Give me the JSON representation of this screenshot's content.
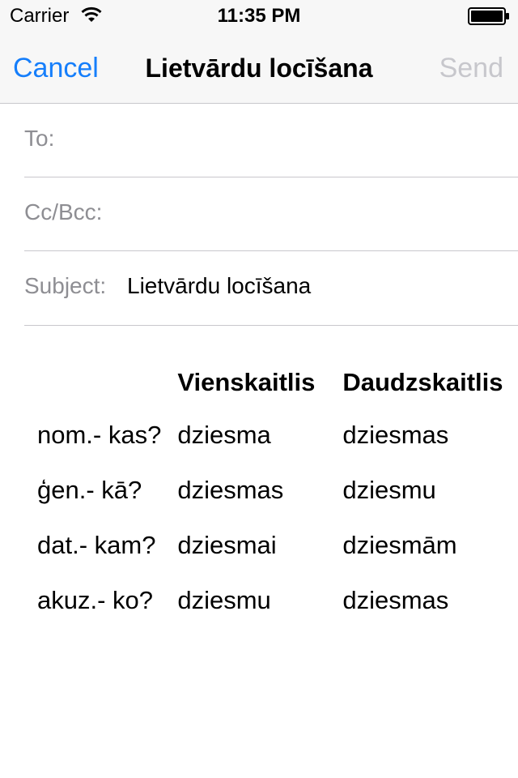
{
  "status_bar": {
    "carrier": "Carrier",
    "time": "11:35 PM",
    "wifi_icon": "wifi-icon",
    "battery_icon": "battery-icon"
  },
  "nav": {
    "cancel_label": "Cancel",
    "title": "Lietvārdu locīšana",
    "send_label": "Send"
  },
  "fields": {
    "to_label": "To:",
    "to_value": "",
    "ccbcc_label": "Cc/Bcc:",
    "ccbcc_value": "",
    "subject_label": "Subject:",
    "subject_value": "Lietvārdu locīšana"
  },
  "table": {
    "headers": [
      "",
      "Vienskaitlis",
      "Daudzskaitlis"
    ],
    "rows": [
      {
        "case": "nom.- kas?",
        "singular": "dziesma",
        "plural": "dziesmas"
      },
      {
        "case": "ģen.- kā?",
        "singular": "dziesmas",
        "plural": "dziesmu"
      },
      {
        "case": "dat.- kam?",
        "singular": "dziesmai",
        "plural": "dziesmām"
      },
      {
        "case": "akuz.- ko?",
        "singular": "dziesmu",
        "plural": "dziesmas"
      }
    ]
  },
  "colors": {
    "accent": "#157efb",
    "disabled": "#c7c7cc",
    "label_gray": "#8e8e93",
    "bar_background": "#f7f7f7",
    "separator": "#c8c7cc"
  }
}
